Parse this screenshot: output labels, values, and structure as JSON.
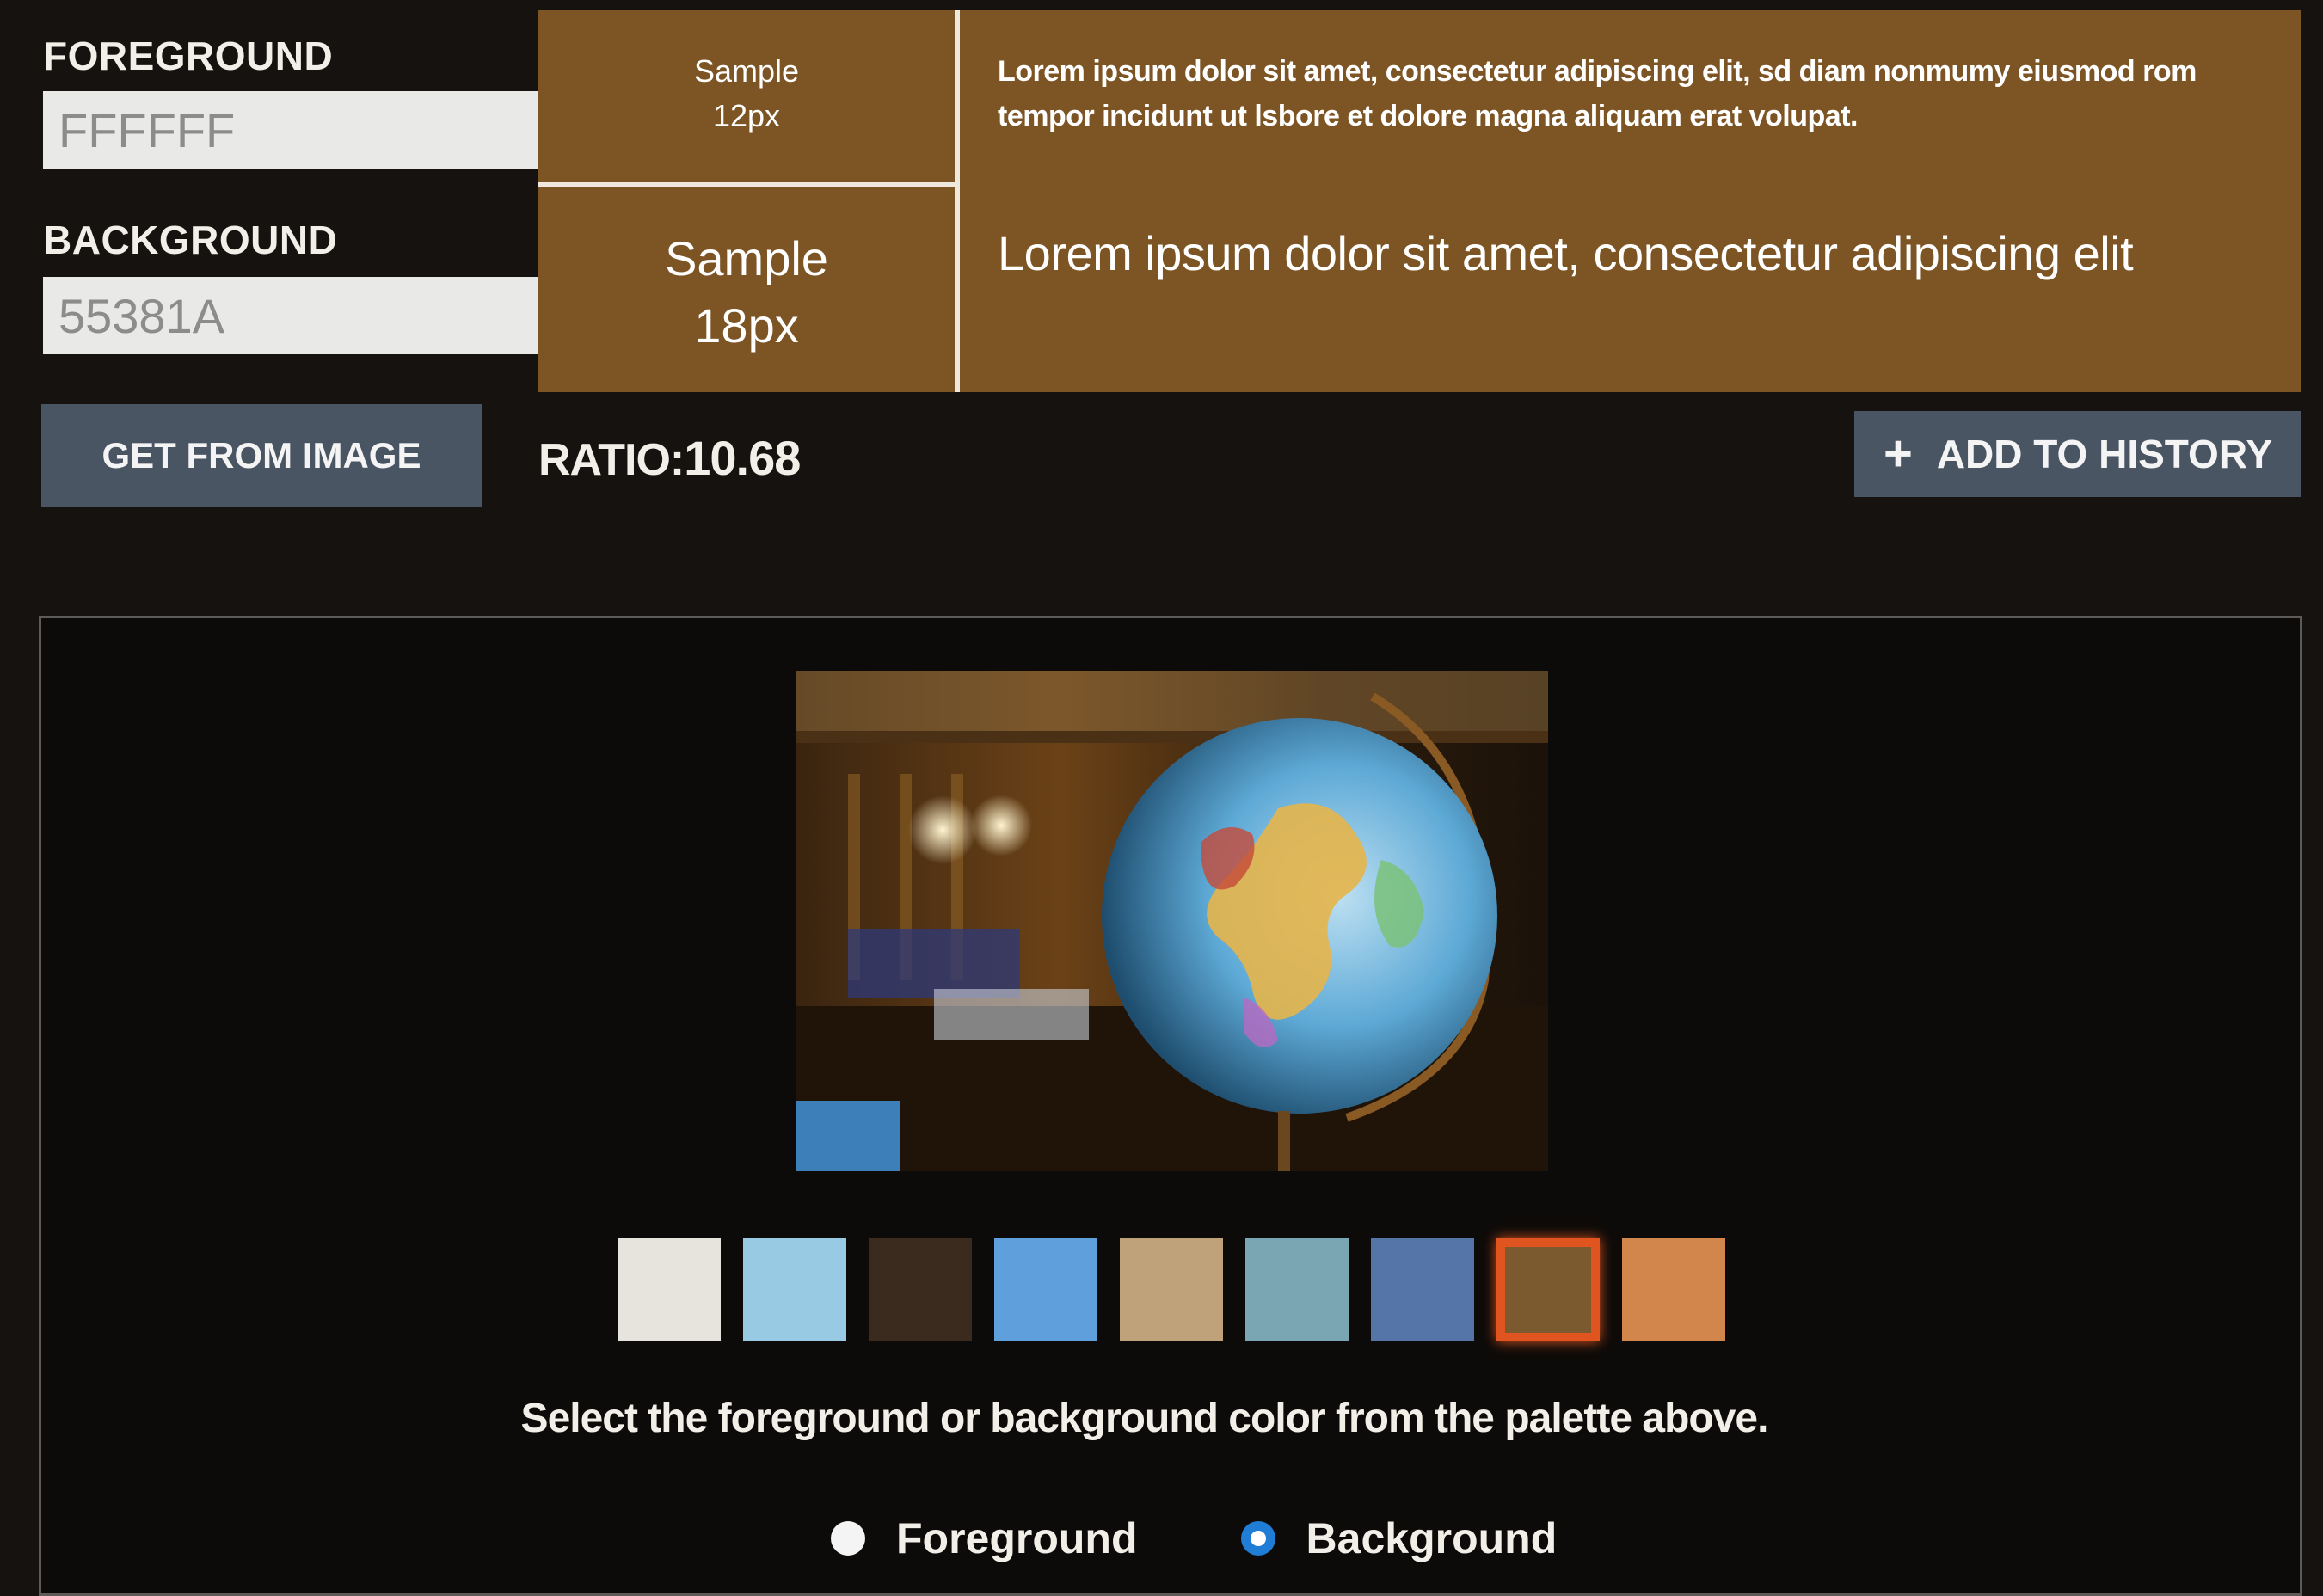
{
  "foreground": {
    "label": "FOREGROUND",
    "value": "FFFFFF",
    "picker_icon": "color-grid-icon"
  },
  "background": {
    "label": "BACKGROUND",
    "value": "55381A",
    "picker_icon": "color-grid-icon"
  },
  "actions": {
    "get_from_image": "GET FROM IMAGE",
    "add_to_history": "ADD TO HISTORY",
    "add_icon": "plus-icon"
  },
  "ratio": {
    "label": "RATIO:",
    "value": "10.68"
  },
  "preview": {
    "background_color": "#7d5524",
    "text_color": "#ffffff",
    "small_label_line1": "Sample",
    "small_label_line2": "12px",
    "large_label_line1": "Sample",
    "large_label_line2": "18px",
    "small_text": "Lorem ipsum dolor sit amet, consectetur adipiscing elit, sd diam nonmumy eiusmod rom tempor incidunt ut lsbore et dolore magna aliquam erat volupat.",
    "large_text": "Lorem ipsum dolor sit amet, consectetur adipiscing elit"
  },
  "image_panel": {
    "image_description_icon": "globe-photo",
    "palette": [
      {
        "color": "#e6e4dd",
        "selected": false
      },
      {
        "color": "#98cbe3",
        "selected": false
      },
      {
        "color": "#3b2a1e",
        "selected": false
      },
      {
        "color": "#5f9fdb",
        "selected": false
      },
      {
        "color": "#bfa17a",
        "selected": false
      },
      {
        "color": "#7aa6b3",
        "selected": false
      },
      {
        "color": "#5575a8",
        "selected": false
      },
      {
        "color": "#7c5a30",
        "selected": true
      },
      {
        "color": "#d3864c",
        "selected": false
      }
    ],
    "instruction": "Select the foreground or background color from the palette above.",
    "radio_options": [
      {
        "label": "Foreground",
        "checked": false
      },
      {
        "label": "Background",
        "checked": true
      }
    ]
  }
}
